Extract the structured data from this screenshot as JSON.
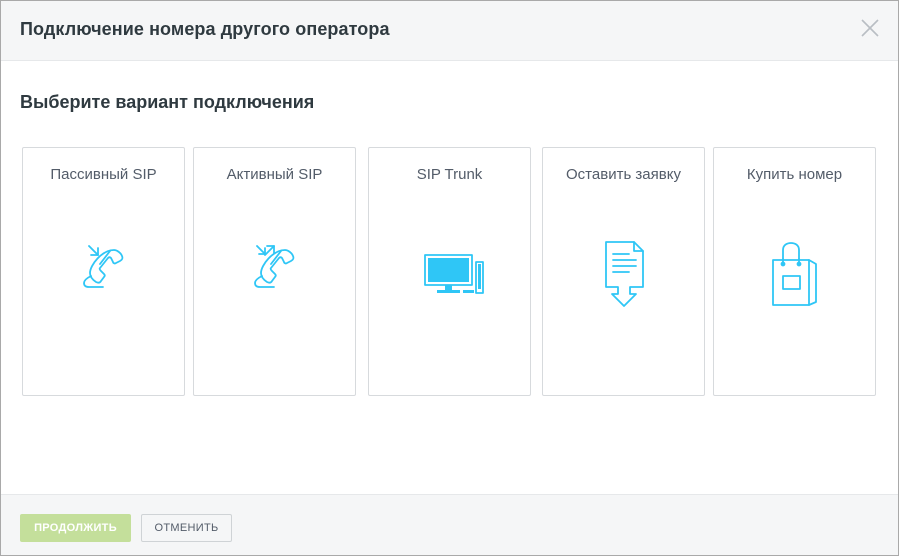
{
  "dialog": {
    "title": "Подключение номера другого оператора",
    "close_icon": "close-icon"
  },
  "main": {
    "section_title": "Выберите вариант подключения",
    "options": [
      {
        "label": "Пассивный SIP",
        "icon": "incoming-call-icon"
      },
      {
        "label": "Активный SIP",
        "icon": "two-way-call-icon"
      },
      {
        "label": "SIP Trunk",
        "icon": "computer-icon"
      },
      {
        "label": "Оставить заявку",
        "icon": "document-download-icon"
      },
      {
        "label": "Купить номер",
        "icon": "shopping-bag-icon"
      }
    ]
  },
  "footer": {
    "continue_label": "ПРОДОЛЖИТЬ",
    "cancel_label": "ОТМЕНИТЬ"
  },
  "colors": {
    "icon": "#2fc6f6",
    "continue_disabled": "#c4df9b",
    "title_text": "#2f3a40",
    "label_text": "#535c69"
  }
}
